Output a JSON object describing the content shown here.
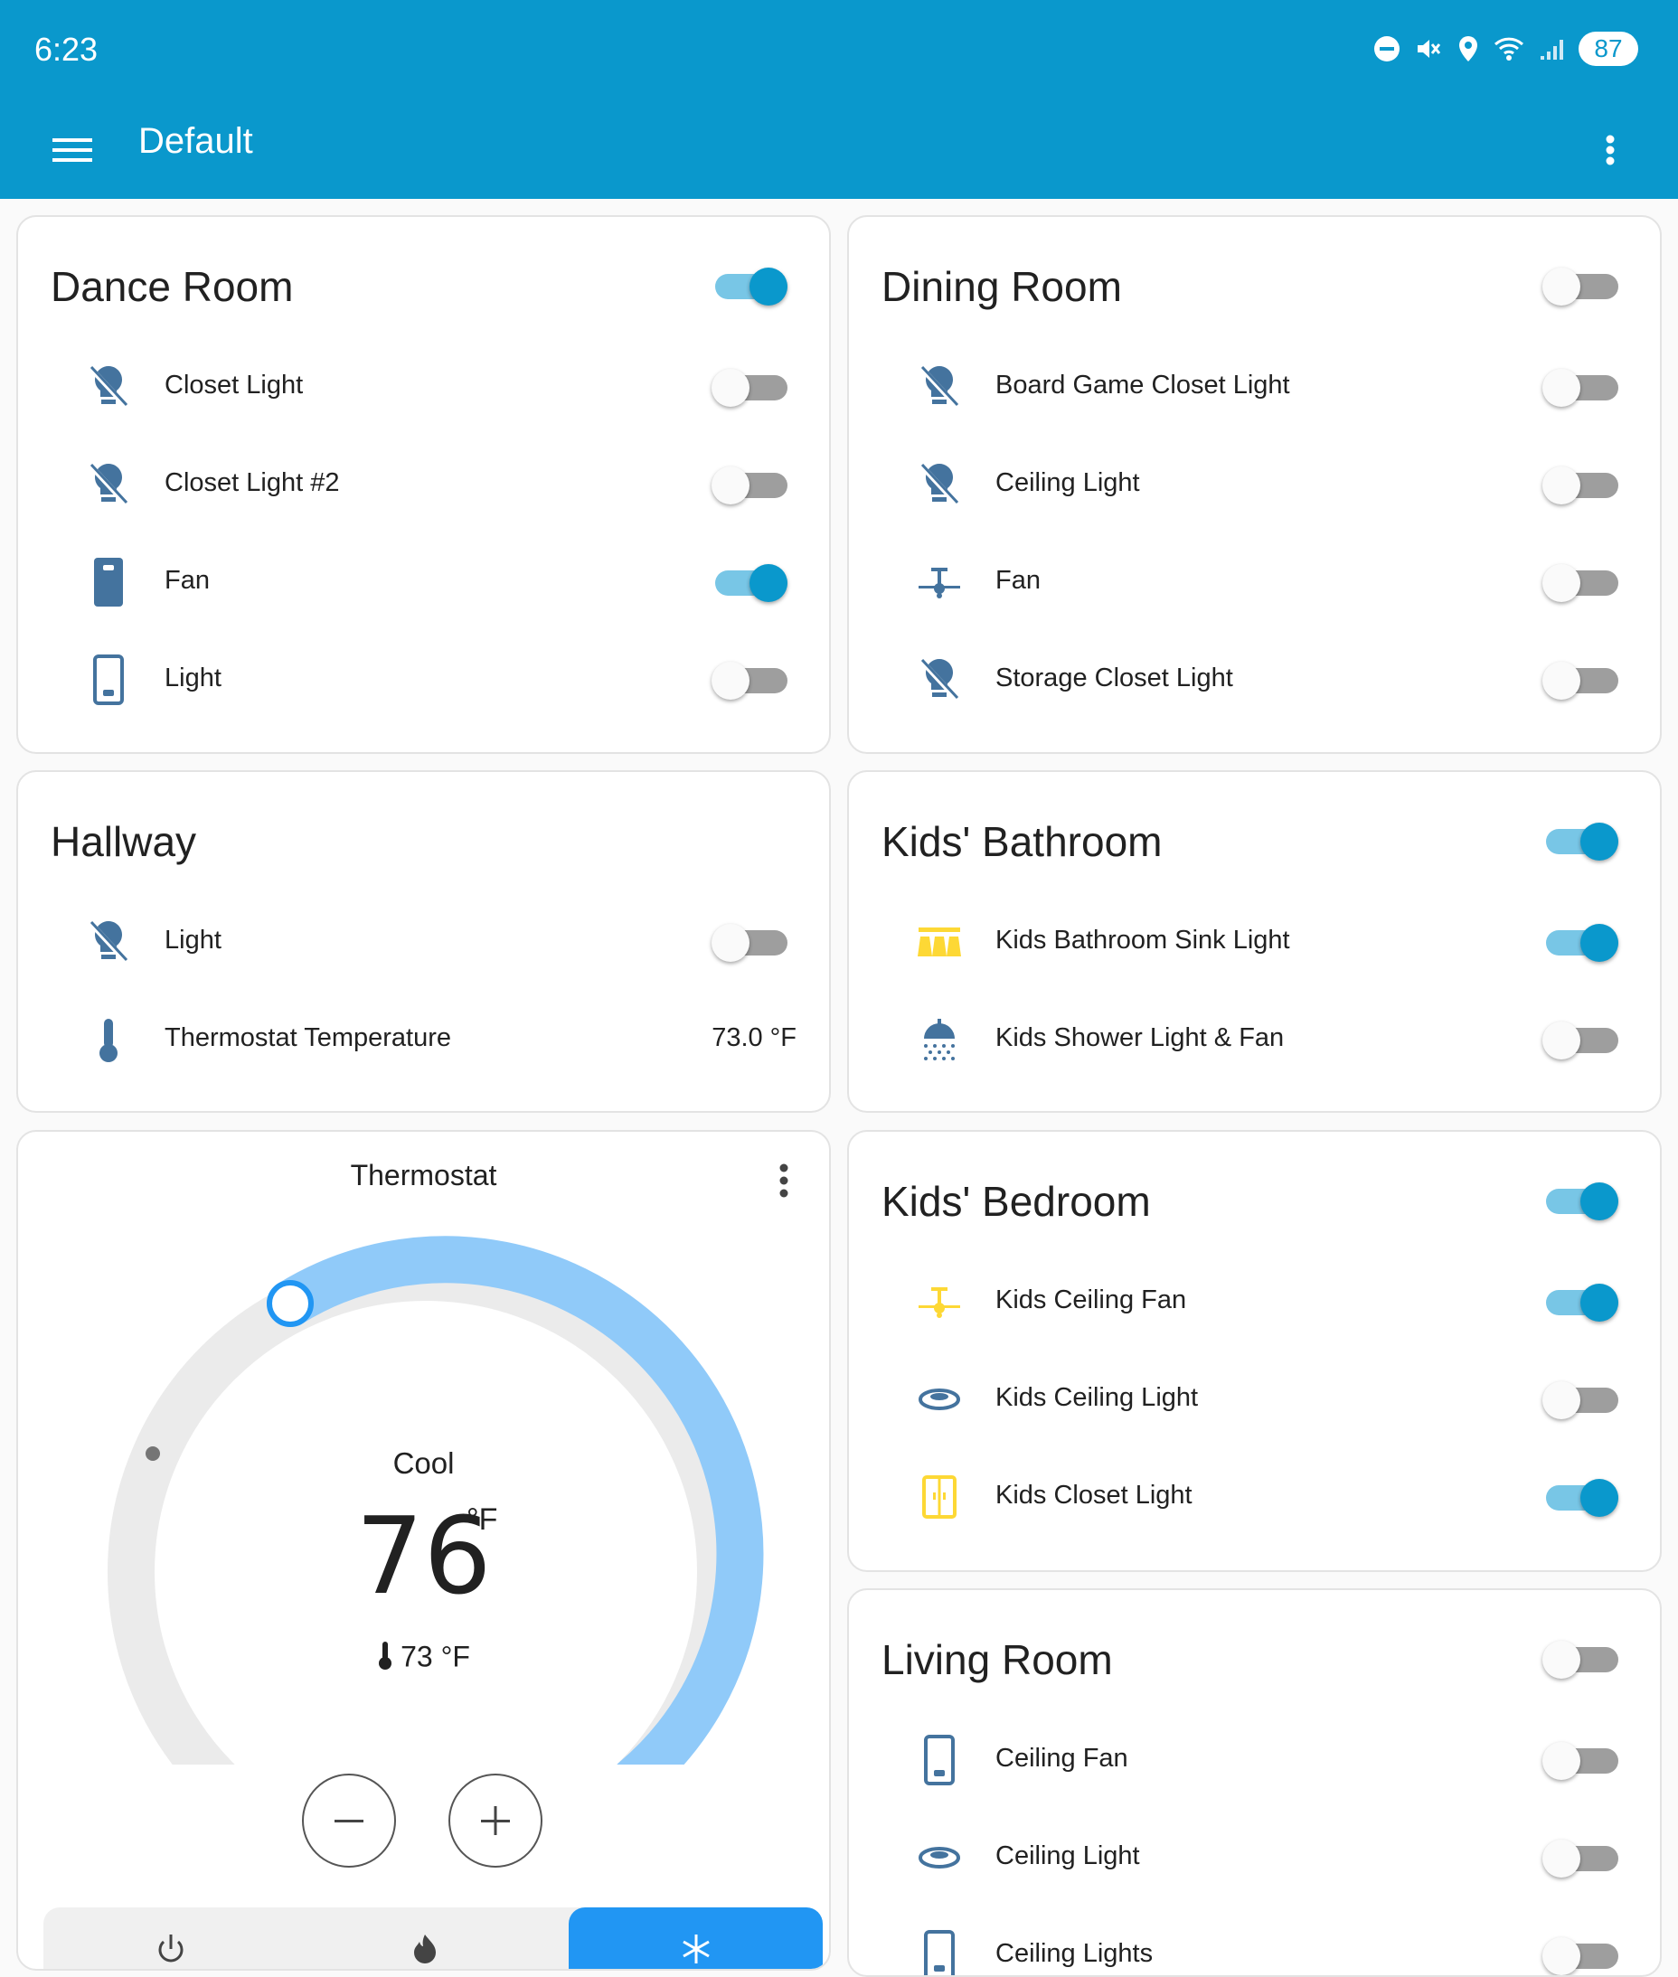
{
  "status_bar": {
    "time": "6:23",
    "battery": "87",
    "icons": [
      "dnd-icon",
      "mute-icon",
      "location-icon",
      "wifi-6-icon",
      "signal-icon"
    ]
  },
  "app_bar": {
    "title": "Default",
    "color": "#0a98cc",
    "icons": [
      "menu-icon",
      "more-vert-icon"
    ]
  },
  "cards": {
    "dance_room": {
      "title": "Dance Room",
      "header_toggle": "on",
      "rows": [
        {
          "label": "Closet Light",
          "icon": "lightbulb-off-icon",
          "state": "off"
        },
        {
          "label": "Closet Light #2",
          "icon": "lightbulb-off-icon",
          "state": "off"
        },
        {
          "label": "Fan",
          "icon": "light-switch-on-icon",
          "state": "on"
        },
        {
          "label": "Light",
          "icon": "light-switch-off-icon",
          "state": "off"
        }
      ]
    },
    "dining_room": {
      "title": "Dining Room",
      "header_toggle": "off",
      "rows": [
        {
          "label": "Board Game Closet Light",
          "icon": "lightbulb-off-icon",
          "state": "off"
        },
        {
          "label": "Ceiling Light",
          "icon": "lightbulb-off-icon",
          "state": "off"
        },
        {
          "label": "Fan",
          "icon": "ceiling-fan-icon",
          "state": "off"
        },
        {
          "label": "Storage Closet Light",
          "icon": "lightbulb-off-icon",
          "state": "off"
        }
      ]
    },
    "hallway": {
      "title": "Hallway",
      "rows": [
        {
          "label": "Light",
          "icon": "lightbulb-off-icon",
          "state": "off"
        },
        {
          "label": "Thermostat Temperature",
          "icon": "thermometer-icon",
          "value": "73.0 °F"
        }
      ]
    },
    "kids_bathroom": {
      "title": "Kids' Bathroom",
      "header_toggle": "on",
      "rows": [
        {
          "label": "Kids Bathroom Sink Light",
          "icon": "vanity-light-icon",
          "state": "on"
        },
        {
          "label": "Kids Shower Light & Fan",
          "icon": "shower-icon",
          "state": "off"
        }
      ]
    },
    "thermostat": {
      "title": "Thermostat",
      "mode": "Cool",
      "target": "76",
      "unit": "°F",
      "current": "73 °F",
      "buttons": {
        "minus": "minus-icon",
        "plus": "plus-icon"
      },
      "modes": [
        "power-icon",
        "fire-icon",
        "snowflake-icon"
      ],
      "active_mode": "snowflake-icon",
      "arc_active_color": "#90caf9",
      "handle_color": "#2196f3"
    },
    "kids_bedroom": {
      "title": "Kids' Bedroom",
      "header_toggle": "on",
      "rows": [
        {
          "label": "Kids Ceiling Fan",
          "icon": "ceiling-fan-icon",
          "state": "on"
        },
        {
          "label": "Kids Ceiling Light",
          "icon": "ceiling-light-icon",
          "state": "off"
        },
        {
          "label": "Kids Closet Light",
          "icon": "closet-icon",
          "state": "on"
        }
      ]
    },
    "living_room": {
      "title": "Living Room",
      "header_toggle": "off",
      "rows": [
        {
          "label": "Ceiling Fan",
          "icon": "light-switch-off-icon",
          "state": "off"
        },
        {
          "label": "Ceiling Light",
          "icon": "ceiling-light-icon",
          "state": "off"
        },
        {
          "label": "Ceiling Lights",
          "icon": "light-switch-off-icon",
          "state": "off"
        }
      ]
    }
  },
  "colors": {
    "icon_blue": "#44739e",
    "icon_active_yellow": "#fdd835",
    "toggle_on": "#0a98cc"
  }
}
